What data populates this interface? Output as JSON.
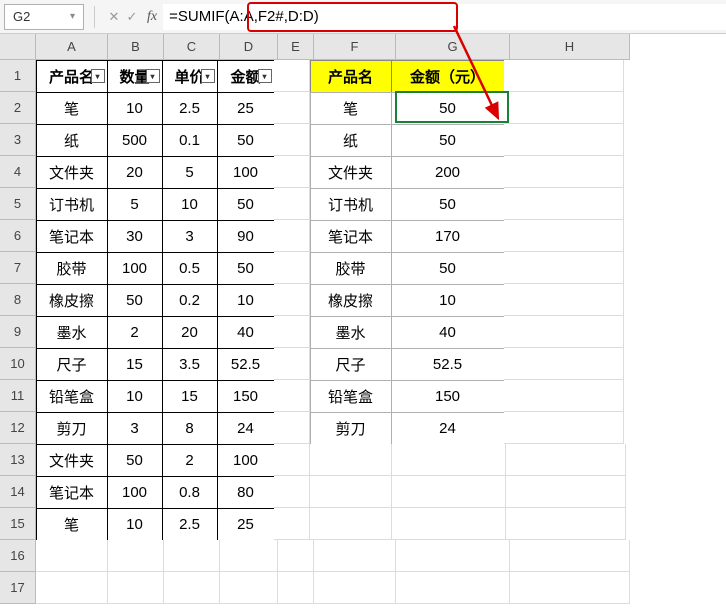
{
  "formula_bar": {
    "name_box": "G2",
    "formula": "=SUMIF(A:A,F2#,D:D)"
  },
  "columns": [
    "A",
    "B",
    "C",
    "D",
    "E",
    "F",
    "G",
    "H"
  ],
  "row_numbers": [
    "1",
    "2",
    "3",
    "4",
    "5",
    "6",
    "7",
    "8",
    "9",
    "10",
    "11",
    "12",
    "13",
    "14",
    "15",
    "16",
    "17"
  ],
  "table1": {
    "headers": [
      "产品名",
      "数量",
      "单价",
      "金额"
    ],
    "rows": [
      [
        "笔",
        "10",
        "2.5",
        "25"
      ],
      [
        "纸",
        "500",
        "0.1",
        "50"
      ],
      [
        "文件夹",
        "20",
        "5",
        "100"
      ],
      [
        "订书机",
        "5",
        "10",
        "50"
      ],
      [
        "笔记本",
        "30",
        "3",
        "90"
      ],
      [
        "胶带",
        "100",
        "0.5",
        "50"
      ],
      [
        "橡皮擦",
        "50",
        "0.2",
        "10"
      ],
      [
        "墨水",
        "2",
        "20",
        "40"
      ],
      [
        "尺子",
        "15",
        "3.5",
        "52.5"
      ],
      [
        "铅笔盒",
        "10",
        "15",
        "150"
      ],
      [
        "剪刀",
        "3",
        "8",
        "24"
      ],
      [
        "文件夹",
        "50",
        "2",
        "100"
      ],
      [
        "笔记本",
        "100",
        "0.8",
        "80"
      ],
      [
        "笔",
        "10",
        "2.5",
        "25"
      ]
    ]
  },
  "table2": {
    "headers": [
      "产品名",
      "金额（元）"
    ],
    "rows": [
      [
        "笔",
        "50"
      ],
      [
        "纸",
        "50"
      ],
      [
        "文件夹",
        "200"
      ],
      [
        "订书机",
        "50"
      ],
      [
        "笔记本",
        "170"
      ],
      [
        "胶带",
        "50"
      ],
      [
        "橡皮擦",
        "10"
      ],
      [
        "墨水",
        "40"
      ],
      [
        "尺子",
        "52.5"
      ],
      [
        "铅笔盒",
        "150"
      ],
      [
        "剪刀",
        "24"
      ]
    ]
  },
  "active_cell": "G2",
  "filter_glyph": "▾"
}
